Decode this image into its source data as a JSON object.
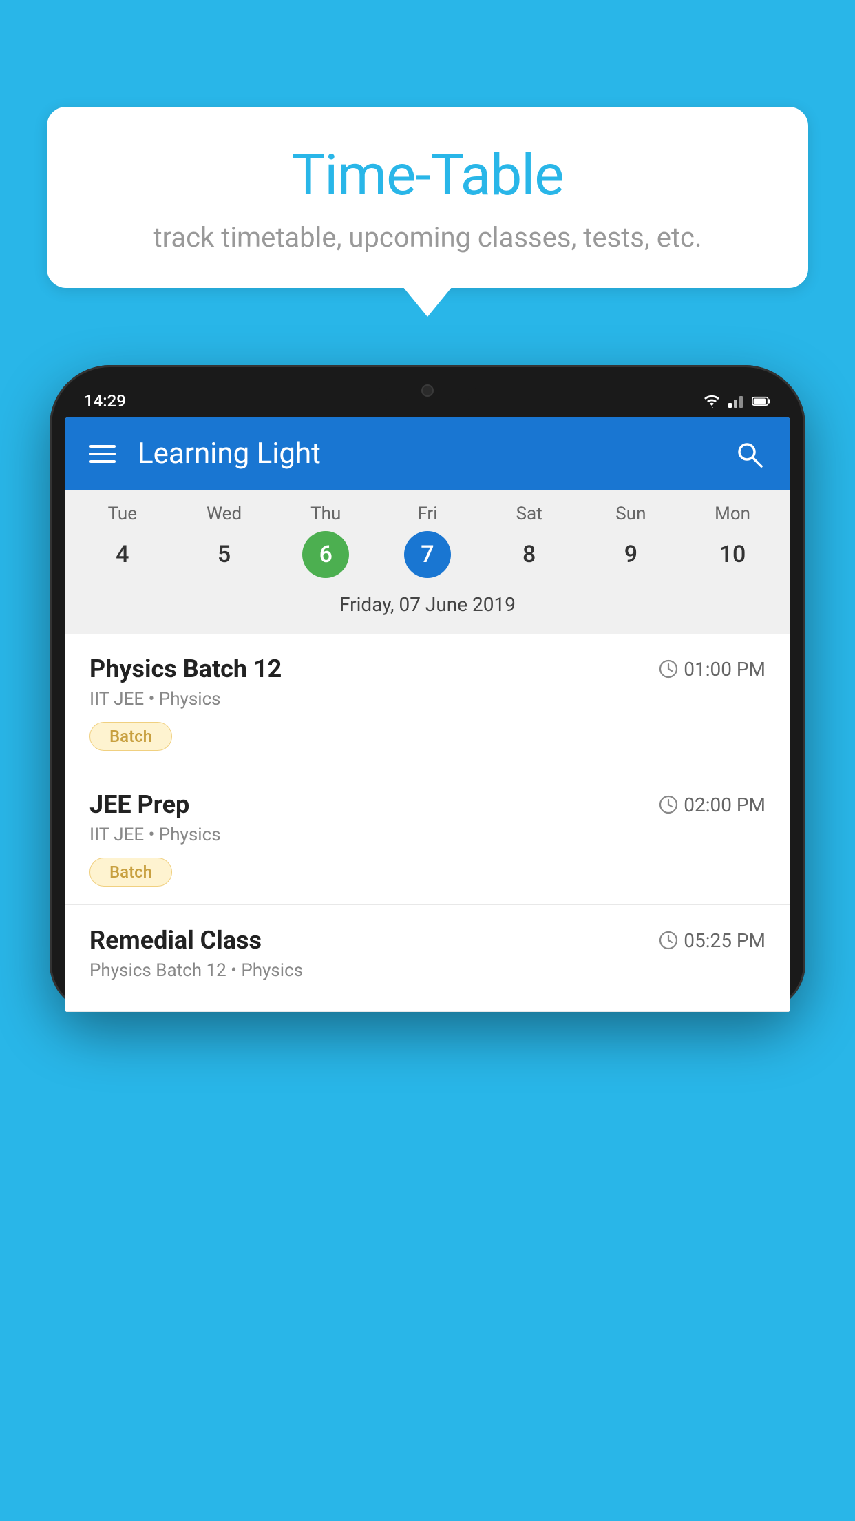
{
  "background_color": "#29b6e8",
  "bubble": {
    "title": "Time-Table",
    "subtitle": "track timetable, upcoming classes, tests, etc."
  },
  "phone": {
    "status_bar": {
      "time": "14:29"
    },
    "header": {
      "app_name": "Learning Light",
      "menu_icon": "menu-icon",
      "search_icon": "search-icon"
    },
    "calendar": {
      "days": [
        {
          "name": "Tue",
          "num": "4",
          "state": "normal"
        },
        {
          "name": "Wed",
          "num": "5",
          "state": "normal"
        },
        {
          "name": "Thu",
          "num": "6",
          "state": "today"
        },
        {
          "name": "Fri",
          "num": "7",
          "state": "selected"
        },
        {
          "name": "Sat",
          "num": "8",
          "state": "normal"
        },
        {
          "name": "Sun",
          "num": "9",
          "state": "normal"
        },
        {
          "name": "Mon",
          "num": "10",
          "state": "normal"
        }
      ],
      "selected_date_label": "Friday, 07 June 2019"
    },
    "schedule": [
      {
        "title": "Physics Batch 12",
        "time": "01:00 PM",
        "subtitle": "IIT JEE • Physics",
        "badge": "Batch"
      },
      {
        "title": "JEE Prep",
        "time": "02:00 PM",
        "subtitle": "IIT JEE • Physics",
        "badge": "Batch"
      },
      {
        "title": "Remedial Class",
        "time": "05:25 PM",
        "subtitle": "Physics Batch 12 • Physics",
        "badge": null
      }
    ]
  }
}
